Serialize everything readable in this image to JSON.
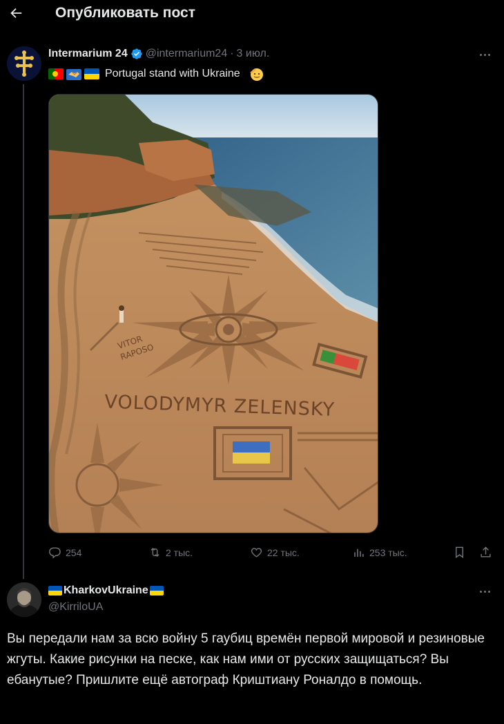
{
  "header": {
    "title": "Опубликовать пост"
  },
  "post": {
    "author_name": "Intermarium 24",
    "handle": "@intermarium24",
    "separator": "·",
    "time": "3 июл.",
    "text": "Portugal stand with Ukraine",
    "image": {
      "sand_text": "VOLODYMYR ZELENSKY",
      "signature_line1": "VITOR",
      "signature_line2": "RAPOSO"
    },
    "stats": {
      "replies": "254",
      "reposts": "2 тыс.",
      "likes": "22 тыс.",
      "views": "253 тыс."
    }
  },
  "reply": {
    "author_name": "KharkovUkraine",
    "handle": "@KirriloUA",
    "text": "Вы передали нам за всю войну 5 гаубиц времён первой мировой и резиновые жгуты. Какие рисунки на песке, как нам ими от русских защищаться? Вы ебанутые? Пришлите ещё автограф Криштиану Роналдо в помощь."
  },
  "colors": {
    "background": "#000000",
    "text_primary": "#e7e9ea",
    "text_secondary": "#71767b",
    "verified_blue": "#1d9bf0",
    "divider": "#333639"
  },
  "icons": [
    "back-arrow-icon",
    "verified-badge-icon",
    "more-icon",
    "reply-icon",
    "repost-icon",
    "like-icon",
    "views-icon",
    "bookmark-icon",
    "share-icon",
    "portugal-flag-icon",
    "handshake-icon",
    "ukraine-flag-icon",
    "salute-face-icon"
  ]
}
